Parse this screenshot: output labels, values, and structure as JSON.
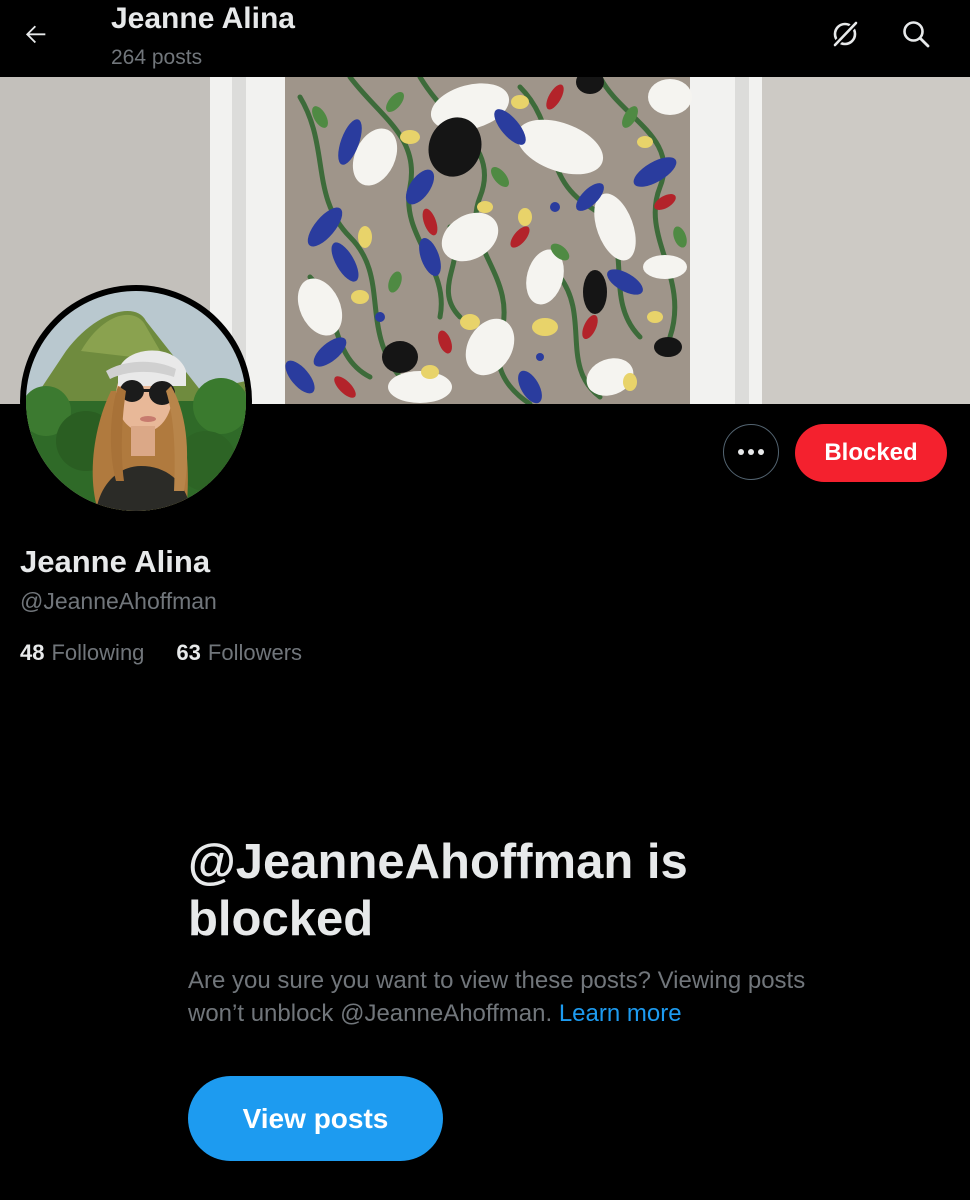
{
  "header": {
    "title": "Jeanne Alina",
    "post_count": "264 posts",
    "back_icon": "arrow-left-icon",
    "grok_icon": "grok-icon",
    "search_icon": "search-icon"
  },
  "banner": {
    "description_icon": "painting-banner"
  },
  "profile": {
    "display_name": "Jeanne Alina",
    "handle": "@JeanneAhoffman",
    "following_count": "48",
    "following_label": "Following",
    "followers_count": "63",
    "followers_label": "Followers"
  },
  "actions": {
    "more_icon": "more-horizontal-icon",
    "blocked_label": "Blocked"
  },
  "blocked_notice": {
    "title": "@JeanneAhoffman is blocked",
    "description": "Are you sure you want to view these posts? Viewing posts won’t unblock @JeanneAhoffman.",
    "learn_more": "Learn more",
    "view_posts_label": "View posts"
  },
  "colors": {
    "background": "#000000",
    "primary_text": "#e7e9ea",
    "secondary_text": "#71767b",
    "blocked_red": "#f4212e",
    "accent_blue": "#1d9bf0"
  }
}
